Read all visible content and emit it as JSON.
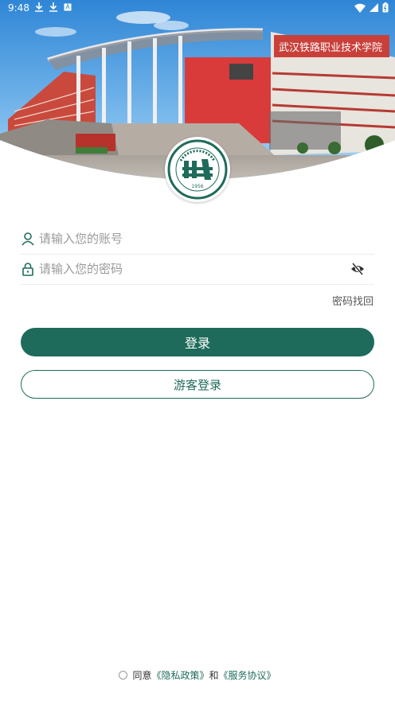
{
  "status_bar": {
    "time": "9:48"
  },
  "header": {
    "banner_text": "武汉铁路职业技术学院",
    "logo_year": "1956"
  },
  "form": {
    "account_placeholder": "请输入您的账号",
    "password_placeholder": "请输入您的密码",
    "recover_label": "密码找回",
    "login_label": "登录",
    "guest_label": "游客登录"
  },
  "agreement": {
    "prefix": "同意",
    "privacy_link": "《隐私政策》",
    "connector": "和",
    "service_link": "《服务协议》"
  },
  "colors": {
    "primary": "#1f6b5b",
    "building_red": "#d93b3b"
  },
  "icons": {
    "account": "user-icon",
    "password": "lock-icon",
    "visibility": "eye-off-icon"
  }
}
